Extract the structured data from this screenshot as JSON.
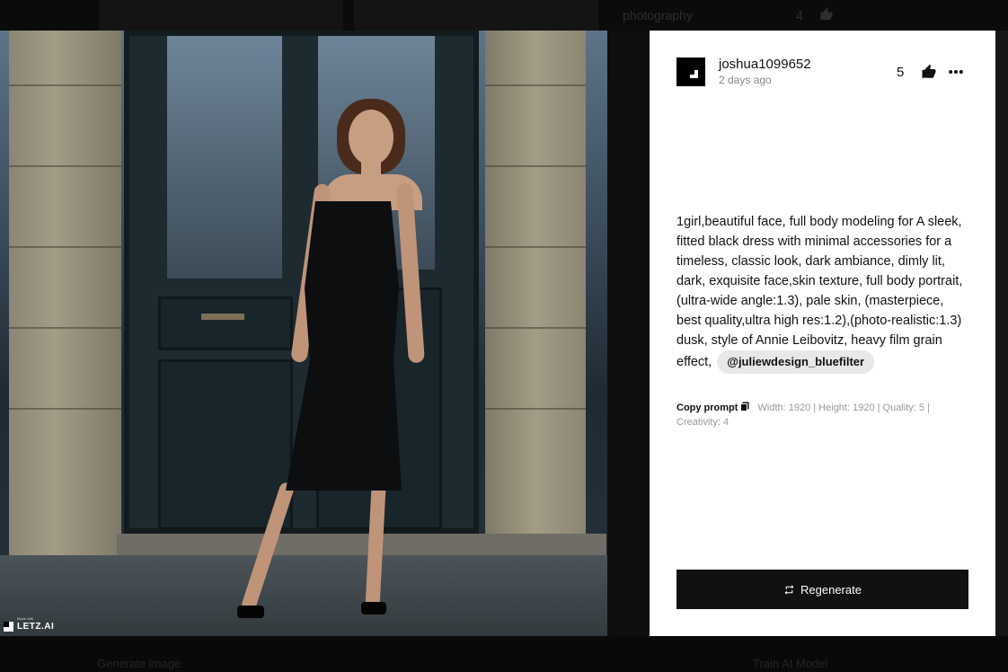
{
  "background": {
    "category_label": "photography",
    "category_count": "4",
    "footer_left": "Generate image",
    "footer_right": "Train AI Model"
  },
  "image": {
    "watermark_small": "Made with",
    "watermark_text": "LETZ.AI"
  },
  "post": {
    "username": "joshua1099652",
    "time_ago": "2 days ago",
    "likes": "5",
    "prompt_text": "1girl,beautiful face, full body modeling for A sleek, fitted black dress with minimal accessories for a timeless, classic look, dark ambiance, dimly lit, dark, exquisite face,skin texture, full body portrait, (ultra-wide angle:1.3), pale skin, (masterpiece, best quality,ultra high res:1.2),(photo-realistic:1.3) dusk, style of Annie Leibovitz, heavy film grain effect,",
    "style_tag": "@juliewdesign_bluefilter",
    "copy_label": "Copy prompt",
    "meta": "Width: 1920 | Height: 1920 | Quality: 5 | Creativity: 4",
    "regenerate_label": "Regenerate"
  },
  "colors": {
    "panel_bg": "#ffffff",
    "button_bg": "#111111",
    "tag_bg": "#e8e8e8",
    "muted_text": "#888888"
  }
}
